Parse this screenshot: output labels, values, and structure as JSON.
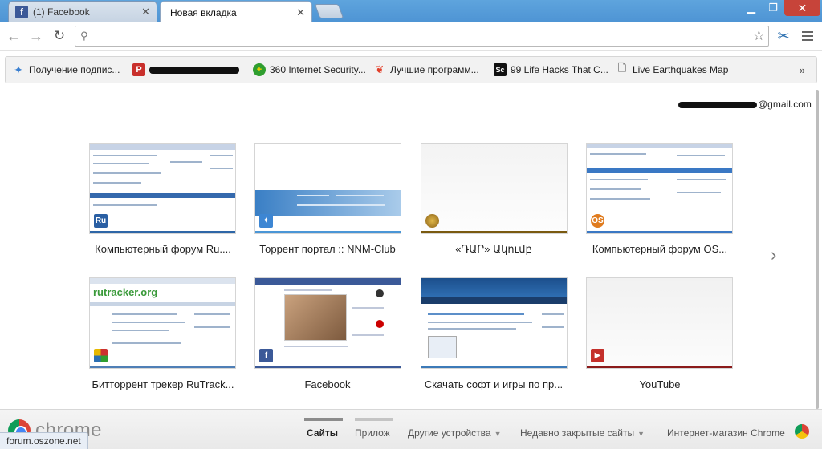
{
  "tabs": [
    {
      "title": "(1) Facebook",
      "icon": "facebook-icon",
      "active": false
    },
    {
      "title": "Новая вкладка",
      "icon": "",
      "active": true
    }
  ],
  "toolbar": {
    "address_value": "",
    "address_placeholder": ""
  },
  "bookmarks": [
    {
      "label": "Получение подпис...",
      "icon": "butterfly-icon"
    },
    {
      "label": "",
      "icon": "redacted-pdf-icon"
    },
    {
      "label": "360 Internet Security...",
      "icon": "360-icon"
    },
    {
      "label": "Лучшие программ...",
      "icon": "fire-icon"
    },
    {
      "label": "99 Life Hacks That C...",
      "icon": "sc-icon"
    },
    {
      "label": "Live Earthquakes Map",
      "icon": "page-icon"
    }
  ],
  "bookmarks_more": "»",
  "account": {
    "suffix": "@gmail.com"
  },
  "most_visited": [
    {
      "caption": "Компьютерный форум Ru....",
      "favicon_text": "Ru",
      "favicon_color": "#2a5fa3",
      "accent": "#2e66a7"
    },
    {
      "caption": "Торрент портал :: NNM-Club",
      "favicon_text": "",
      "favicon_color": "#3d86d3",
      "accent": "#4a96d6"
    },
    {
      "caption": "«ԴԱՐ» Ակումբ",
      "favicon_text": "",
      "favicon_color": "#b98a2b",
      "accent": "#7a5a10"
    },
    {
      "caption": "Компьютерный форум OS...",
      "favicon_text": "OS",
      "favicon_color": "#e07c1f",
      "accent": "#3a78c4"
    },
    {
      "caption": "Битторрент трекер RuTrack...",
      "favicon_text": "",
      "favicon_color": "#cc3030",
      "accent": "#4f7fb6"
    },
    {
      "caption": "Facebook",
      "favicon_text": "f",
      "favicon_color": "#3b5998",
      "accent": "#3b5998"
    },
    {
      "caption": "Скачать софт и игры по пр...",
      "favicon_text": "",
      "favicon_color": "#2a6fb3",
      "accent": "#3c7ab8"
    },
    {
      "caption": "YouTube",
      "favicon_text": "▶",
      "favicon_color": "#c4302b",
      "accent": "#8b1a1a"
    }
  ],
  "next_arrow": "›",
  "footer": {
    "brand": "chrome",
    "tabs": [
      {
        "label": "Сайты",
        "active": true
      },
      {
        "label": "Прилож",
        "active": false
      },
      {
        "label": "Другие устройства",
        "active": false
      },
      {
        "label": "Недавно закрытые сайты",
        "active": false
      },
      {
        "label": "Интернет-магазин Chrome",
        "active": false
      }
    ]
  },
  "status_url": "forum.oszone.net"
}
